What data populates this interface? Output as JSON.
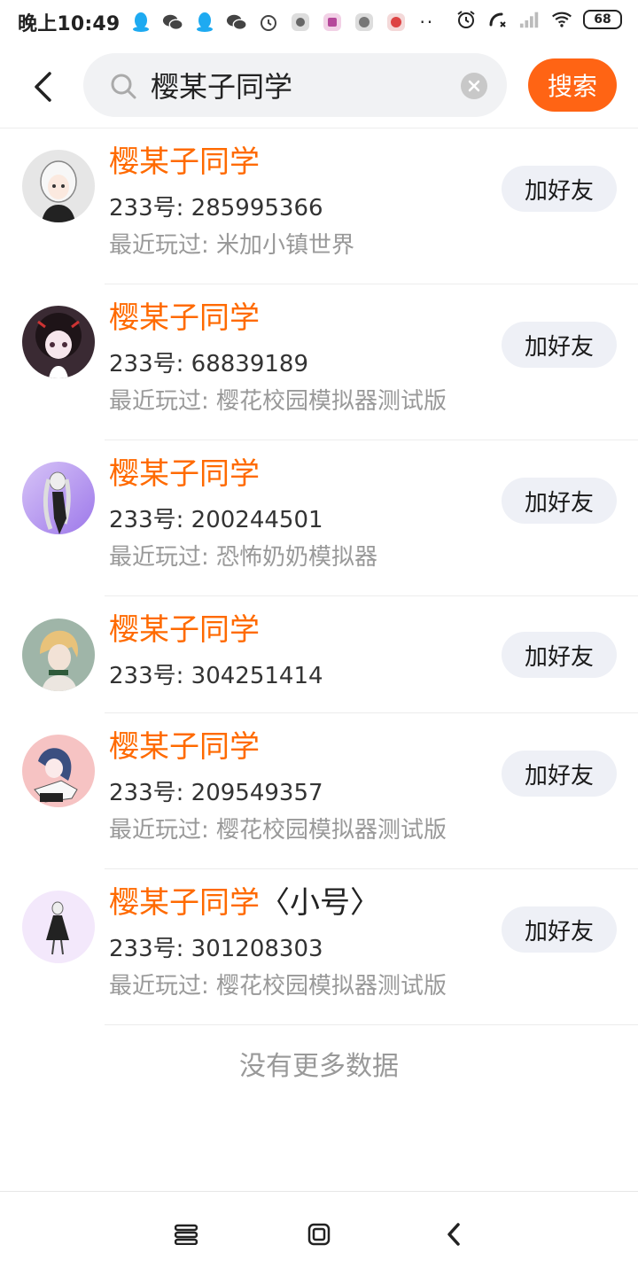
{
  "status_bar": {
    "time": "晚上10:49",
    "left_icons": [
      "qq-icon",
      "wechat-icon",
      "qq-icon",
      "wechat-icon",
      "alarm-icon",
      "app-icon",
      "app-icon",
      "app-icon",
      "app-icon"
    ],
    "more_dots": "··",
    "right_icons": [
      "alarm-icon",
      "call-missed-icon",
      "signal-icon",
      "wifi-icon"
    ],
    "battery": "68"
  },
  "search": {
    "value": "樱某子同学",
    "button_label": "搜索"
  },
  "results": [
    {
      "name_highlight": "樱某子同学",
      "name_suffix": "",
      "id_text": "233号: 285995366",
      "played_text": "最近玩过: 米加小镇世界",
      "button_label": "加好友",
      "avatar_bg": "#e6e6e6"
    },
    {
      "name_highlight": "樱某子同学",
      "name_suffix": "",
      "id_text": "233号: 68839189",
      "played_text": "最近玩过: 樱花校园模拟器测试版",
      "button_label": "加好友",
      "avatar_bg": "#3a2a33"
    },
    {
      "name_highlight": "樱某子同学",
      "name_suffix": "",
      "id_text": "233号: 200244501",
      "played_text": "最近玩过: 恐怖奶奶模拟器",
      "button_label": "加好友",
      "avatar_bg": "#b89af0"
    },
    {
      "name_highlight": "樱某子同学",
      "name_suffix": "",
      "id_text": "233号: 304251414",
      "played_text": "",
      "button_label": "加好友",
      "avatar_bg": "#9fb5a8"
    },
    {
      "name_highlight": "樱某子同学",
      "name_suffix": "",
      "id_text": "233号: 209549357",
      "played_text": "最近玩过: 樱花校园模拟器测试版",
      "button_label": "加好友",
      "avatar_bg": "#f6c3c3"
    },
    {
      "name_highlight": "樱某子同学",
      "name_suffix": "〈小号〉",
      "id_text": "233号: 301208303",
      "played_text": "最近玩过: 樱花校园模拟器测试版",
      "button_label": "加好友",
      "avatar_bg": "#f3e8fb"
    }
  ],
  "no_more_text": "没有更多数据",
  "colors": {
    "accent": "#ff6414",
    "highlight": "#ff6a00"
  }
}
